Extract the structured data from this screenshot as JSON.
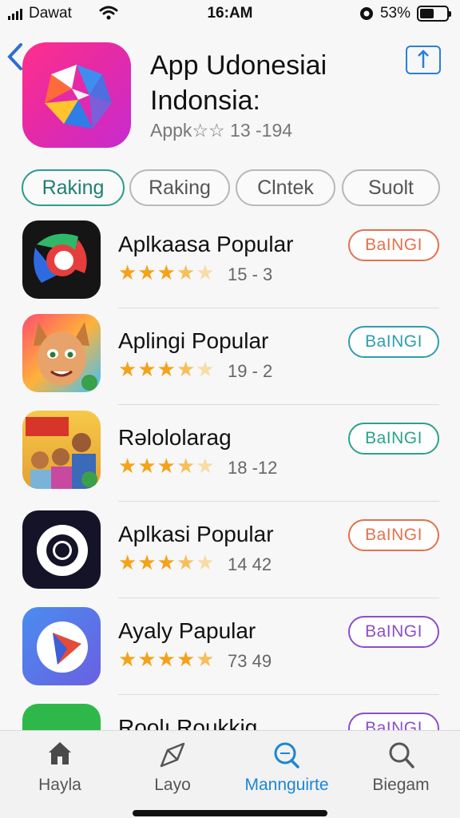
{
  "status_bar": {
    "carrier": "Dawat",
    "time": "16:AM",
    "battery": "53%",
    "battery_level": 0.53
  },
  "header": {
    "title": "App Udonesiai Indonsia:",
    "subtitle": "Appk☆☆ 13 -194",
    "back_icon": "chevron-left-icon",
    "share_icon": "share-icon",
    "accent": "#2a7fd8"
  },
  "tabs": [
    {
      "label": "Raking",
      "active": true
    },
    {
      "label": "Raking",
      "active": false
    },
    {
      "label": "Clntek",
      "active": false
    },
    {
      "label": "Suolt",
      "active": false
    }
  ],
  "apps": [
    {
      "name": "Aplkaasa Popular",
      "rating": 3.5,
      "meta": "15 - 3",
      "button": "BaINGI",
      "button_color": "#e2714d"
    },
    {
      "name": "Aplingi Popular",
      "rating": 3.5,
      "meta": "19 - 2",
      "button": "BaINGI",
      "button_color": "#2e9db0"
    },
    {
      "name": "Rəlololarag",
      "rating": 3.5,
      "meta": "18 -12",
      "button": "BaINGI",
      "button_color": "#2aa38a"
    },
    {
      "name": "Aplkasi Popular",
      "rating": 3.5,
      "meta": "14 42",
      "button": "BaINGI",
      "button_color": "#e2714d"
    },
    {
      "name": "Ayaly Papular",
      "rating": 4.5,
      "meta": "73 49",
      "button": "BaINGI",
      "button_color": "#8c4fc8"
    },
    {
      "name": "Roolı Roukkig",
      "rating": 0,
      "meta": "",
      "button": "BaINGI",
      "button_color": "#8c4fc8"
    }
  ],
  "bottom_nav": [
    {
      "label": "Hayla",
      "icon": "home-icon",
      "active": false
    },
    {
      "label": "Layo",
      "icon": "compass-pen-icon",
      "active": false
    },
    {
      "label": "Mannguirte",
      "icon": "search-icon",
      "active": true
    },
    {
      "label": "Biegam",
      "icon": "magnifier-icon",
      "active": false
    }
  ]
}
